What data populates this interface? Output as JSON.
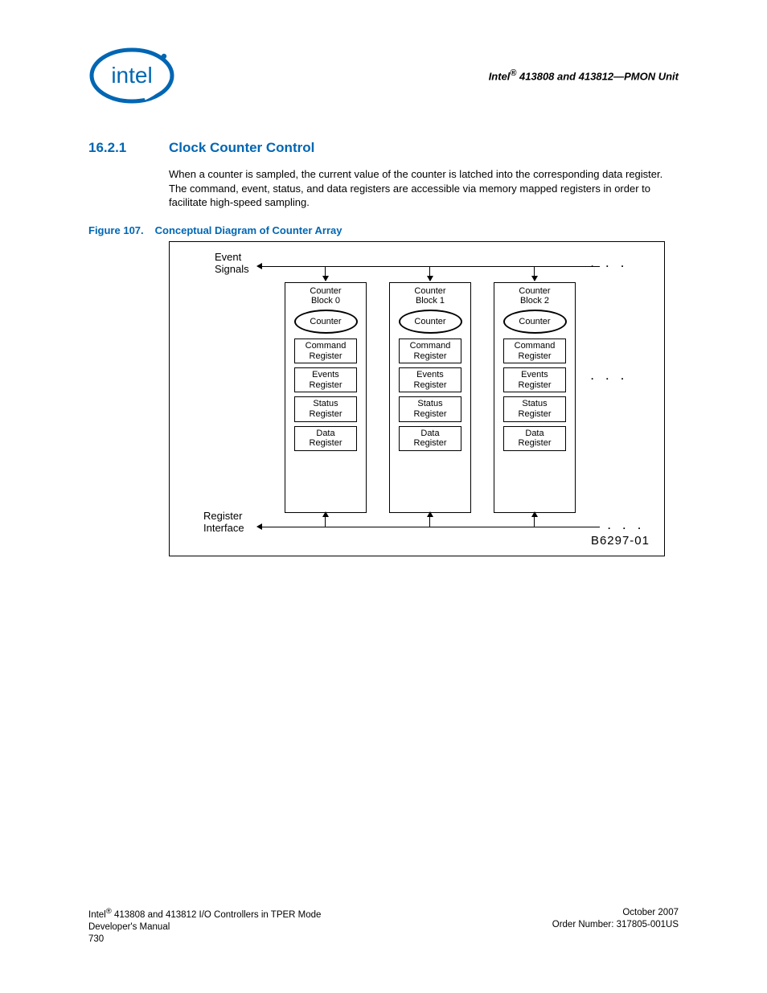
{
  "header": {
    "brand_prefix": "Intel",
    "right": " 413808 and 413812—PMON Unit"
  },
  "section": {
    "number": "16.2.1",
    "title": "Clock Counter Control",
    "paragraph": "When a counter is sampled, the current value of the counter is latched into the corresponding data register. The command, event, status, and data registers are accessible via memory mapped registers in order to facilitate high-speed sampling."
  },
  "figure": {
    "num": "Figure 107.",
    "title": "Conceptual Diagram of Counter Array",
    "top_label_l1": "Event",
    "top_label_l2": "Signals",
    "bottom_label_l1": "Register",
    "bottom_label_l2": "Interface",
    "code": "B6297-01",
    "blocks": [
      {
        "title_l1": "Counter",
        "title_l2": "Block 0"
      },
      {
        "title_l1": "Counter",
        "title_l2": "Block 1"
      },
      {
        "title_l1": "Counter",
        "title_l2": "Block 2"
      }
    ],
    "oval": "Counter",
    "regs": [
      {
        "l1": "Command",
        "l2": "Register"
      },
      {
        "l1": "Events",
        "l2": "Register"
      },
      {
        "l1": "Status",
        "l2": "Register"
      },
      {
        "l1": "Data",
        "l2": "Register"
      }
    ],
    "dots": ". . ."
  },
  "footer": {
    "left_l1_prefix": "Intel",
    "left_l1_suffix": " 413808 and 413812 I/O Controllers in TPER Mode",
    "left_l2": "Developer's Manual",
    "left_l3": "730",
    "right_l1": "October 2007",
    "right_l2": "Order Number: 317805-001US"
  }
}
